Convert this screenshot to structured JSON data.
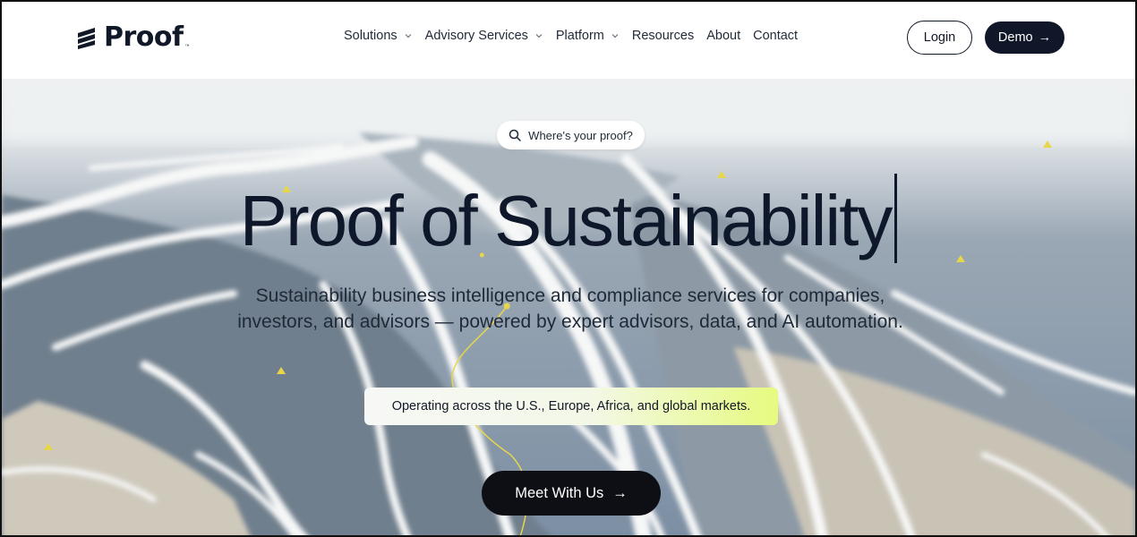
{
  "brand": {
    "name": "Proof",
    "trademark": "™"
  },
  "nav": {
    "items": [
      {
        "label": "Solutions",
        "has_dropdown": true
      },
      {
        "label": "Advisory Services",
        "has_dropdown": true
      },
      {
        "label": "Platform",
        "has_dropdown": true
      },
      {
        "label": "Resources",
        "has_dropdown": false
      },
      {
        "label": "About",
        "has_dropdown": false
      },
      {
        "label": "Contact",
        "has_dropdown": false
      }
    ],
    "login_label": "Login",
    "demo_label": "Demo",
    "demo_arrow": "→"
  },
  "hero": {
    "search_label": "Where's your proof?",
    "headline": "Proof of Sustainability",
    "subtext": "Sustainability business intelligence and compliance services for companies, investors,  and advisors — powered by expert advisors, data, and AI automation.",
    "markets_label": "Operating across the U.S., Europe, Africa, and global markets.",
    "cta_label": "Meet With Us",
    "cta_arrow": "→"
  },
  "icons": {
    "logo": "proof-logo-icon",
    "search": "search-icon",
    "dropdown": "chevron-down-icon",
    "arrow": "arrow-right-icon"
  },
  "colors": {
    "primary_dark": "#0f1729",
    "cta_dark": "#0d0f14",
    "accent_lime": "#e6fb7e",
    "marker_yellow": "#e8d64a",
    "text": "#111827"
  }
}
